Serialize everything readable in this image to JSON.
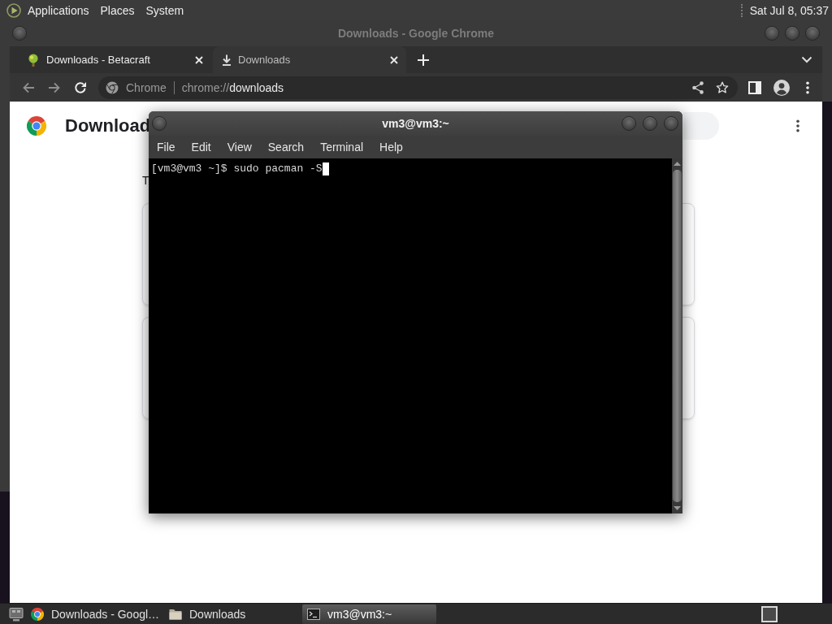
{
  "top_panel": {
    "menus": [
      "Applications",
      "Places",
      "System"
    ],
    "clock": "Sat Jul 8, 05:37"
  },
  "browser": {
    "title": "Downloads - Google Chrome",
    "tabs": [
      {
        "label": "Downloads - Betacraft",
        "kind": "site",
        "selected": false
      },
      {
        "label": "Downloads",
        "kind": "downloads",
        "selected": true
      }
    ],
    "toolbar": {
      "back_disabled": true,
      "forward_disabled": true,
      "chip": "Chrome",
      "url_scheme": "chrome://",
      "url_path": "downloads"
    },
    "page": {
      "heading": "Download",
      "date_heading": "T"
    }
  },
  "terminal": {
    "title": "vm3@vm3:~",
    "menus": [
      "File",
      "Edit",
      "View",
      "Search",
      "Terminal",
      "Help"
    ],
    "lines": [
      "[vm3@vm3 ~]$ sudo pacman -S"
    ]
  },
  "taskbar": {
    "items": [
      {
        "label": "Downloads - Googl…",
        "kind": "browser",
        "selected": false
      },
      {
        "label": "Downloads",
        "kind": "folder",
        "selected": false
      },
      {
        "label": "vm3@vm3:~",
        "kind": "terminal",
        "selected": true
      }
    ]
  }
}
